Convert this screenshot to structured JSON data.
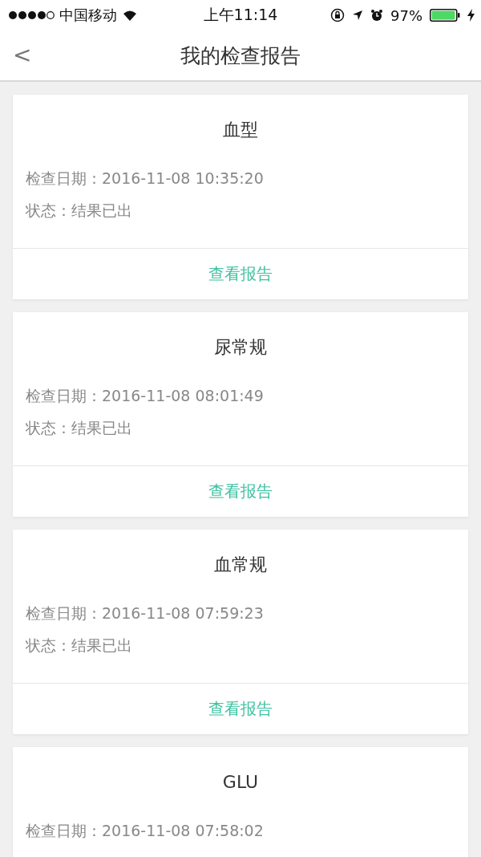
{
  "status_bar": {
    "carrier": "中国移动",
    "time": "上午11:14",
    "battery": "97%"
  },
  "nav": {
    "back": "<",
    "title": "我的检查报告"
  },
  "reports": [
    {
      "title": "血型",
      "date_label": "检查日期：",
      "date": "2016-11-08 10:35:20",
      "status_label": "状态：",
      "status": "结果已出",
      "action": "查看报告"
    },
    {
      "title": "尿常规",
      "date_label": "检查日期：",
      "date": "2016-11-08 08:01:49",
      "status_label": "状态：",
      "status": "结果已出",
      "action": "查看报告"
    },
    {
      "title": "血常规",
      "date_label": "检查日期：",
      "date": "2016-11-08 07:59:23",
      "status_label": "状态：",
      "status": "结果已出",
      "action": "查看报告"
    },
    {
      "title": "GLU",
      "date_label": "检查日期：",
      "date": "2016-11-08 07:58:02"
    }
  ]
}
